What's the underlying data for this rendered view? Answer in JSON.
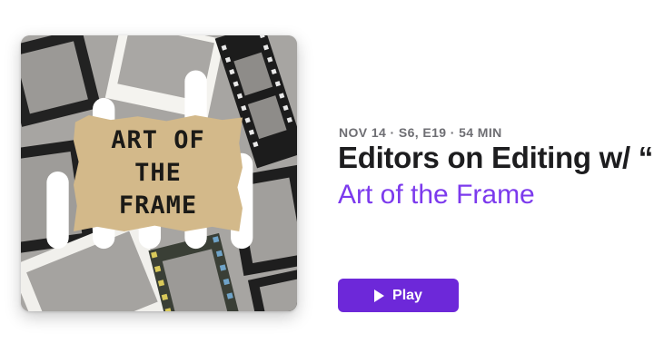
{
  "artwork": {
    "title_lines": [
      "ART OF",
      "THE",
      "FRAME"
    ],
    "badge_icon": "anchor-podcast-icon",
    "background_color": "#a7a5a2",
    "tape_color": "#d3b98a"
  },
  "episode": {
    "meta": "NOV 14 · S6, E19 · 54 MIN",
    "title": "Editors on Editing w/ “P",
    "show_name": "Art of the Frame",
    "accent_color": "#7c3aed"
  },
  "actions": {
    "play_label": "Play",
    "play_icon": "play-icon",
    "button_color": "#6d28d9"
  }
}
